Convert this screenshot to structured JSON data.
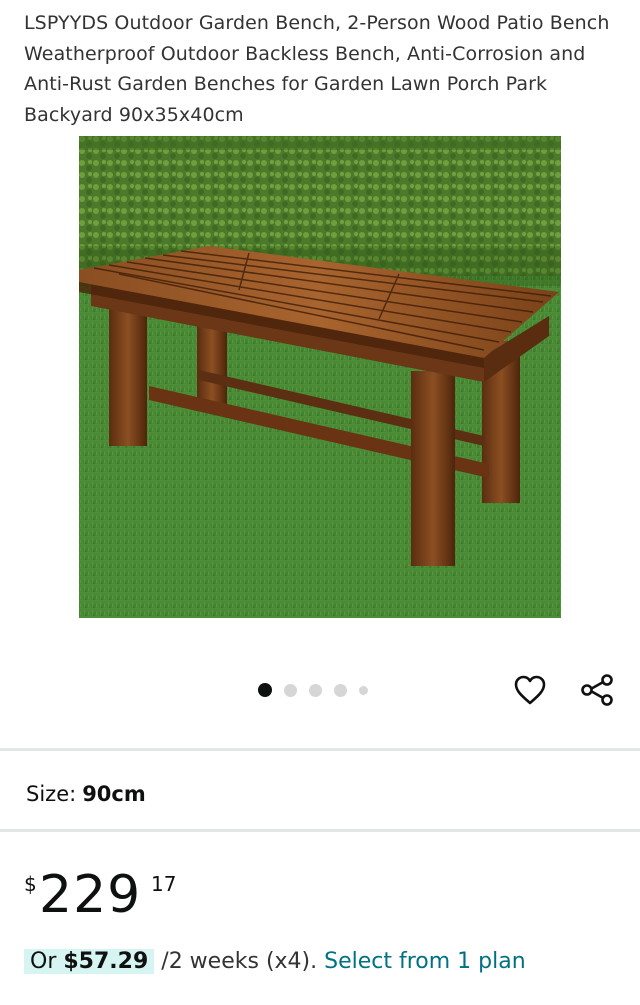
{
  "product": {
    "title": "LSPYYDS Outdoor Garden Bench, 2-Person Wood Patio Bench Weatherproof Outdoor Backless Bench, Anti-Corrosion and Anti-Rust Garden Benches for Garden Lawn Porch Park Backyard 90x35x40cm"
  },
  "gallery": {
    "image_alt": "Wooden garden bench on grass in front of a hedge",
    "dot_count": 5,
    "active_dot": 1
  },
  "actions": {
    "favorite_icon": "heart-icon",
    "share_icon": "share-icon"
  },
  "size": {
    "label": "Size:",
    "value": "90cm"
  },
  "price": {
    "currency_symbol": "$",
    "whole": "229",
    "fraction": "17"
  },
  "installment": {
    "prefix": "Or",
    "amount": "$57.29",
    "terms": "/2 weeks (x4).",
    "link_text": "Select from 1 plan"
  },
  "colors": {
    "link": "#007185",
    "installment_highlight": "#d6f4f1",
    "divider": "#e3e6e6",
    "text": "#0f1111"
  }
}
